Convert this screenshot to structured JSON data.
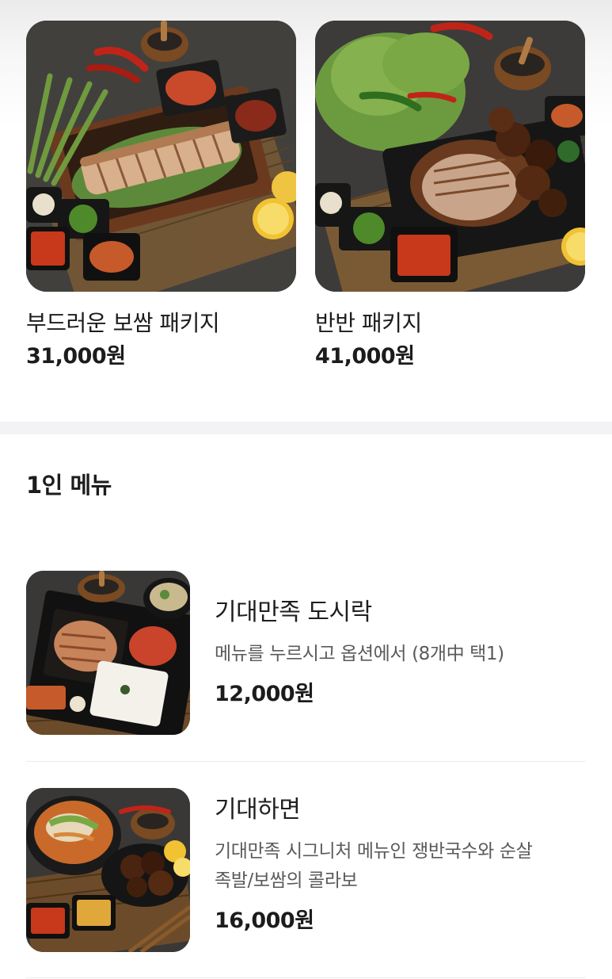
{
  "packages": [
    {
      "name": "부드러운 보쌈 패키지",
      "price": "31,000원",
      "image": "bossam-package-photo"
    },
    {
      "name": "반반 패키지",
      "price": "41,000원",
      "image": "half-half-package-photo"
    }
  ],
  "single_menu": {
    "title": "1인 메뉴",
    "items": [
      {
        "name": "기대만족 도시락",
        "desc_lines": [
          "메뉴를 누르시고 옵션에서 (8개中 택1)"
        ],
        "price": "12,000원",
        "image": "lunchbox-photo"
      },
      {
        "name": "기대하면",
        "desc_lines": [
          "기대만족 시그니처 메뉴인 쟁반국수와 순살",
          "족발/보쌈의 콜라보"
        ],
        "price": "16,000원",
        "image": "noodle-combo-photo"
      }
    ]
  },
  "colors": {
    "text": "#1c1c1c",
    "desc": "#5a5a5a",
    "divider": "#f3f3f5",
    "photo_bg": "#2b2b2b"
  }
}
